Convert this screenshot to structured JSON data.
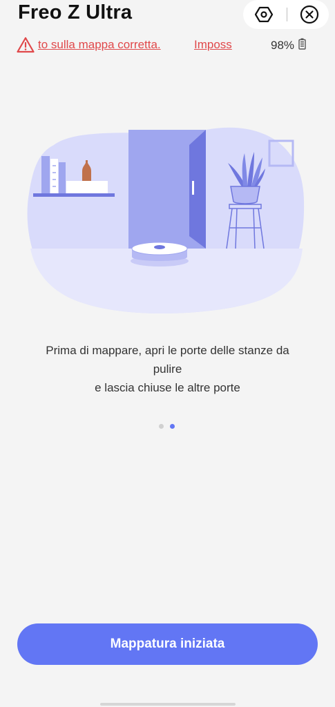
{
  "header": {
    "title": "Freo Z Ultra",
    "settings_icon": "hexagon-nut-icon",
    "close_icon": "close-circle-icon"
  },
  "warning": {
    "icon": "warning-triangle-icon",
    "text": "to sulla mappa corretta.",
    "link_label": "Imposs",
    "color": "#e0484a"
  },
  "status": {
    "battery_percent": "98%",
    "battery_icon": "battery-icon"
  },
  "illustration": {
    "name": "room-with-open-door-and-robot-vacuum",
    "colors": {
      "blob": "#d9dbfb",
      "wall": "#c9cbf7",
      "door": "#9fa6ef",
      "door_dark": "#6f77de"
    }
  },
  "instructions": {
    "line1": "Prima di mappare, apri le porte delle stanze da",
    "line2": "pulire",
    "line3": "e lascia chiuse le altre porte"
  },
  "pager": {
    "total": 2,
    "active_index": 1,
    "active_color": "#6276f4",
    "inactive_color": "#d0d0d0"
  },
  "actions": {
    "primary_label": "Mappatura iniziata",
    "primary_color": "#6276f4"
  }
}
